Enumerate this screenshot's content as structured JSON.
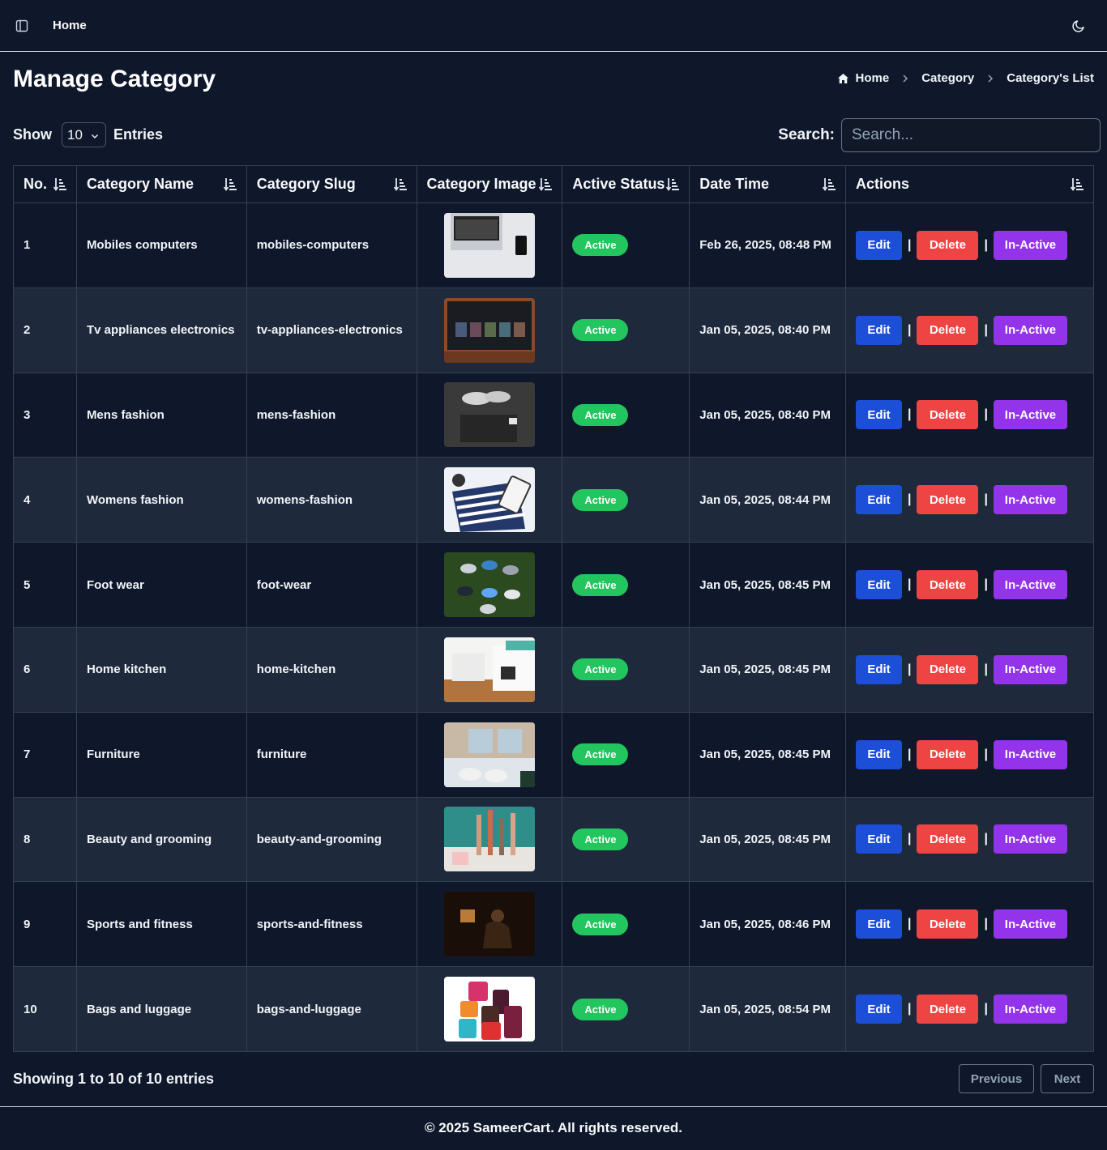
{
  "topbar": {
    "home_label": "Home"
  },
  "page": {
    "title": "Manage Category"
  },
  "breadcrumb": {
    "items": [
      "Home",
      "Category",
      "Category's List"
    ]
  },
  "controls": {
    "show_label": "Show",
    "entries_value": "10",
    "entries_label": "Entries",
    "search_label": "Search:",
    "search_placeholder": "Search..."
  },
  "table": {
    "headers": [
      "No.",
      "Category Name",
      "Category Slug",
      "Category Image",
      "Active Status",
      "Date Time",
      "Actions"
    ],
    "rows": [
      {
        "no": "1",
        "name": "Mobiles computers",
        "slug": "mobiles-computers",
        "status": "Active",
        "datetime": "Feb 26, 2025, 08:48 PM"
      },
      {
        "no": "2",
        "name": "Tv appliances electronics",
        "slug": "tv-appliances-electronics",
        "status": "Active",
        "datetime": "Jan 05, 2025, 08:40 PM"
      },
      {
        "no": "3",
        "name": "Mens fashion",
        "slug": "mens-fashion",
        "status": "Active",
        "datetime": "Jan 05, 2025, 08:40 PM"
      },
      {
        "no": "4",
        "name": "Womens fashion",
        "slug": "womens-fashion",
        "status": "Active",
        "datetime": "Jan 05, 2025, 08:44 PM"
      },
      {
        "no": "5",
        "name": "Foot wear",
        "slug": "foot-wear",
        "status": "Active",
        "datetime": "Jan 05, 2025, 08:45 PM"
      },
      {
        "no": "6",
        "name": "Home kitchen",
        "slug": "home-kitchen",
        "status": "Active",
        "datetime": "Jan 05, 2025, 08:45 PM"
      },
      {
        "no": "7",
        "name": "Furniture",
        "slug": "furniture",
        "status": "Active",
        "datetime": "Jan 05, 2025, 08:45 PM"
      },
      {
        "no": "8",
        "name": "Beauty and grooming",
        "slug": "beauty-and-grooming",
        "status": "Active",
        "datetime": "Jan 05, 2025, 08:45 PM"
      },
      {
        "no": "9",
        "name": "Sports and fitness",
        "slug": "sports-and-fitness",
        "status": "Active",
        "datetime": "Jan 05, 2025, 08:46 PM"
      },
      {
        "no": "10",
        "name": "Bags and luggage",
        "slug": "bags-and-luggage",
        "status": "Active",
        "datetime": "Jan 05, 2025, 08:54 PM"
      }
    ],
    "actions": {
      "edit": "Edit",
      "delete": "Delete",
      "inactive": "In-Active",
      "separator": "|"
    }
  },
  "pagination": {
    "summary": "Showing 1 to 10 of 10 entries",
    "previous": "Previous",
    "next": "Next"
  },
  "footer": {
    "copyright": "© 2025 SameerCart. All rights reserved."
  },
  "colors": {
    "background": "#0f172a",
    "row_alt": "#1e293b",
    "edit": "#1d4ed8",
    "delete": "#ef4444",
    "inactive": "#9333ea",
    "active_badge": "#22c55e"
  },
  "icons": {
    "sidebar_toggle": "sidebar-toggle-icon",
    "theme": "moon-icon",
    "breadcrumb_home": "home-icon",
    "breadcrumb_separator": "chevron-right-icon",
    "sort": "sort-icon",
    "select": "chevron-down-icon"
  }
}
